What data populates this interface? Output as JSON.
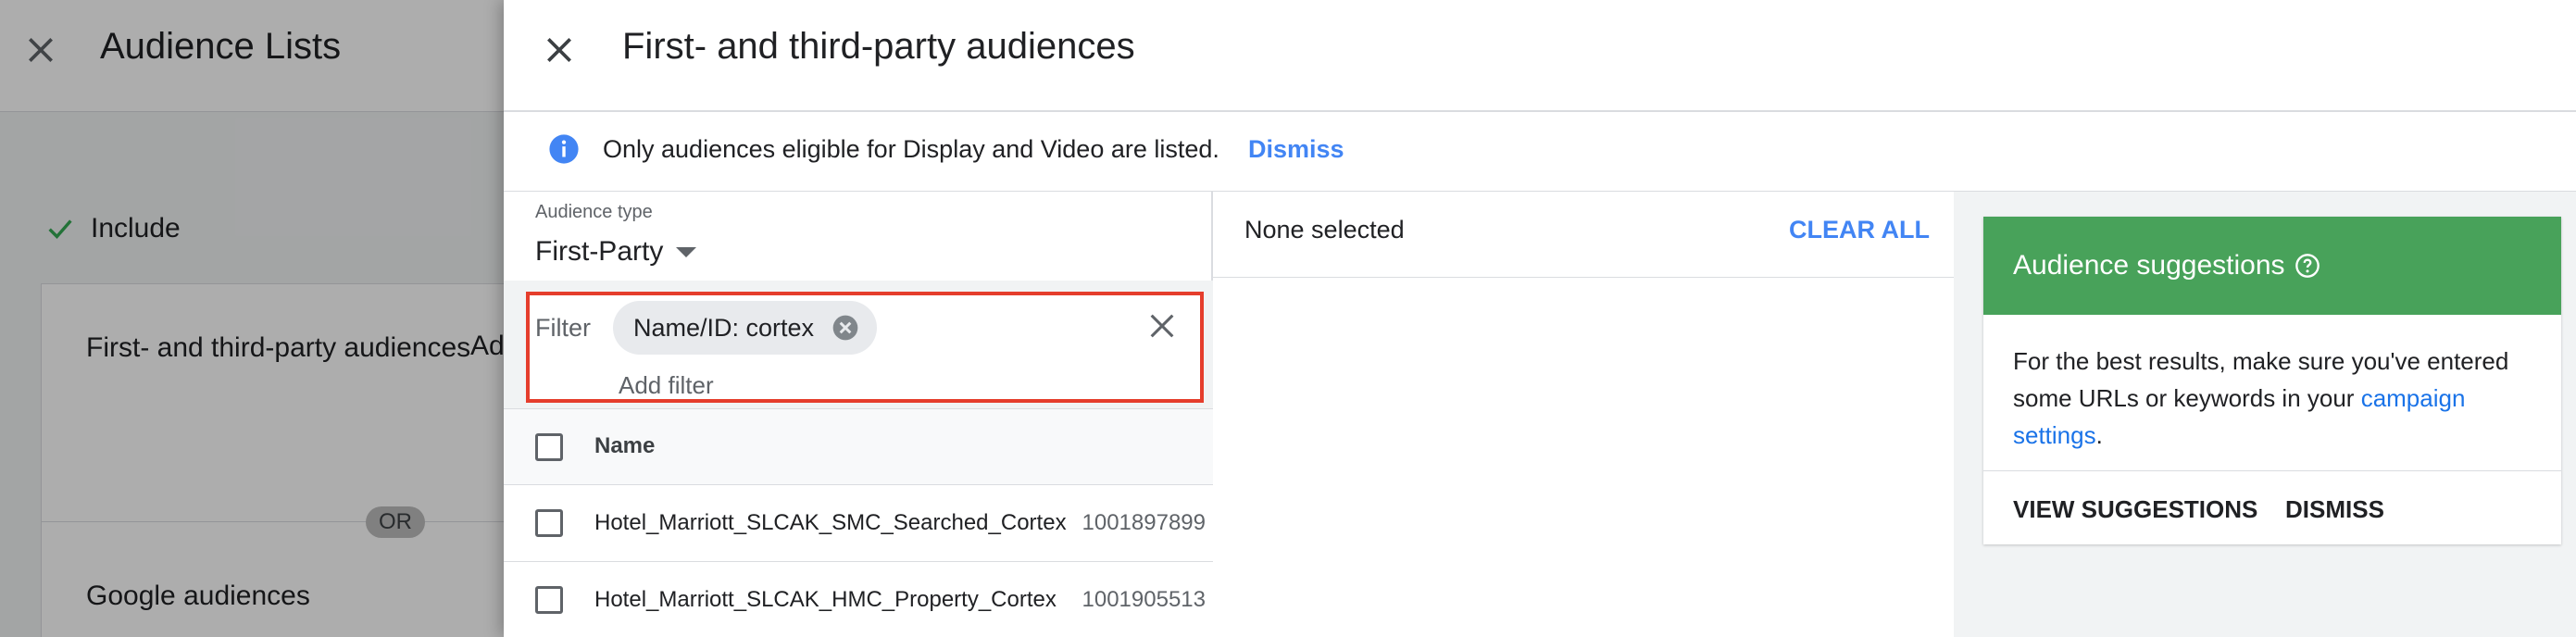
{
  "background_page": {
    "title": "Audience Lists",
    "include_label": "Include",
    "card_title_1": "First- and third-party audiences",
    "card_add_partial": "Add",
    "or_label": "OR",
    "card_title_2": "Google audiences"
  },
  "panel": {
    "title": "First- and third-party audiences",
    "info_text": "Only audiences eligible for Display and Video are listed.",
    "info_dismiss": "Dismiss"
  },
  "audience_type": {
    "label": "Audience type",
    "value": "First-Party"
  },
  "filter": {
    "label": "Filter",
    "chip": "Name/ID: cortex",
    "add_filter": "Add filter"
  },
  "table": {
    "header_name": "Name",
    "rows": [
      {
        "name": "Hotel_Marriott_SLCAK_SMC_Searched_Cortex",
        "id": "1001897899"
      },
      {
        "name": "Hotel_Marriott_SLCAK_HMC_Property_Cortex",
        "id": "1001905513"
      }
    ]
  },
  "selection": {
    "none_selected": "None selected",
    "clear_all": "CLEAR ALL"
  },
  "suggestions": {
    "title": "Audience suggestions",
    "body_prefix": "For the best results, make sure you've entered some URLs or keywords in your ",
    "body_link": "campaign settings",
    "body_suffix": ".",
    "view_button": "VIEW SUGGESTIONS",
    "dismiss_button": "DISMISS"
  },
  "colors": {
    "accent_blue": "#4285f4",
    "link_blue": "#1a73e8",
    "suggestion_green": "#48a25a",
    "filter_highlight_red": "#e53d2c"
  }
}
